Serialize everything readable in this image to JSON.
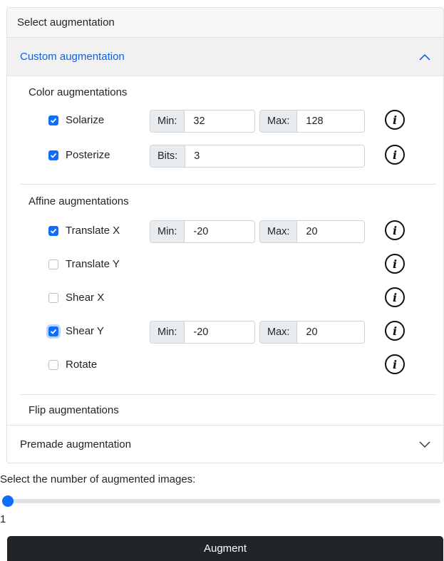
{
  "panel": {
    "header": "Select augmentation"
  },
  "custom": {
    "title": "Custom augmentation",
    "expanded": true
  },
  "sections": {
    "color": "Color augmentations",
    "affine": "Affine augmentations",
    "flip": "Flip augmentations"
  },
  "color_items": {
    "solarize": {
      "label": "Solarize",
      "checked": true,
      "min_label": "Min:",
      "min": "32",
      "max_label": "Max:",
      "max": "128"
    },
    "posterize": {
      "label": "Posterize",
      "checked": true,
      "bits_label": "Bits:",
      "bits": "3"
    }
  },
  "affine_items": {
    "translate_x": {
      "label": "Translate X",
      "checked": true,
      "min_label": "Min:",
      "min": "-20",
      "max_label": "Max:",
      "max": "20"
    },
    "translate_y": {
      "label": "Translate Y",
      "checked": false
    },
    "shear_x": {
      "label": "Shear X",
      "checked": false
    },
    "shear_y": {
      "label": "Shear Y",
      "checked": true,
      "min_label": "Min:",
      "min": "-20",
      "max_label": "Max:",
      "max": "20"
    },
    "rotate": {
      "label": "Rotate",
      "checked": false
    }
  },
  "info_glyph": "i",
  "premade": {
    "title": "Premade augmentation",
    "expanded": false
  },
  "slider": {
    "label": "Select the number of augmented images:",
    "value": "1"
  },
  "augment_button": "Augment",
  "colors": {
    "accent": "#0d6efd",
    "header_text": "#0c63e4",
    "button_bg": "#212529"
  }
}
